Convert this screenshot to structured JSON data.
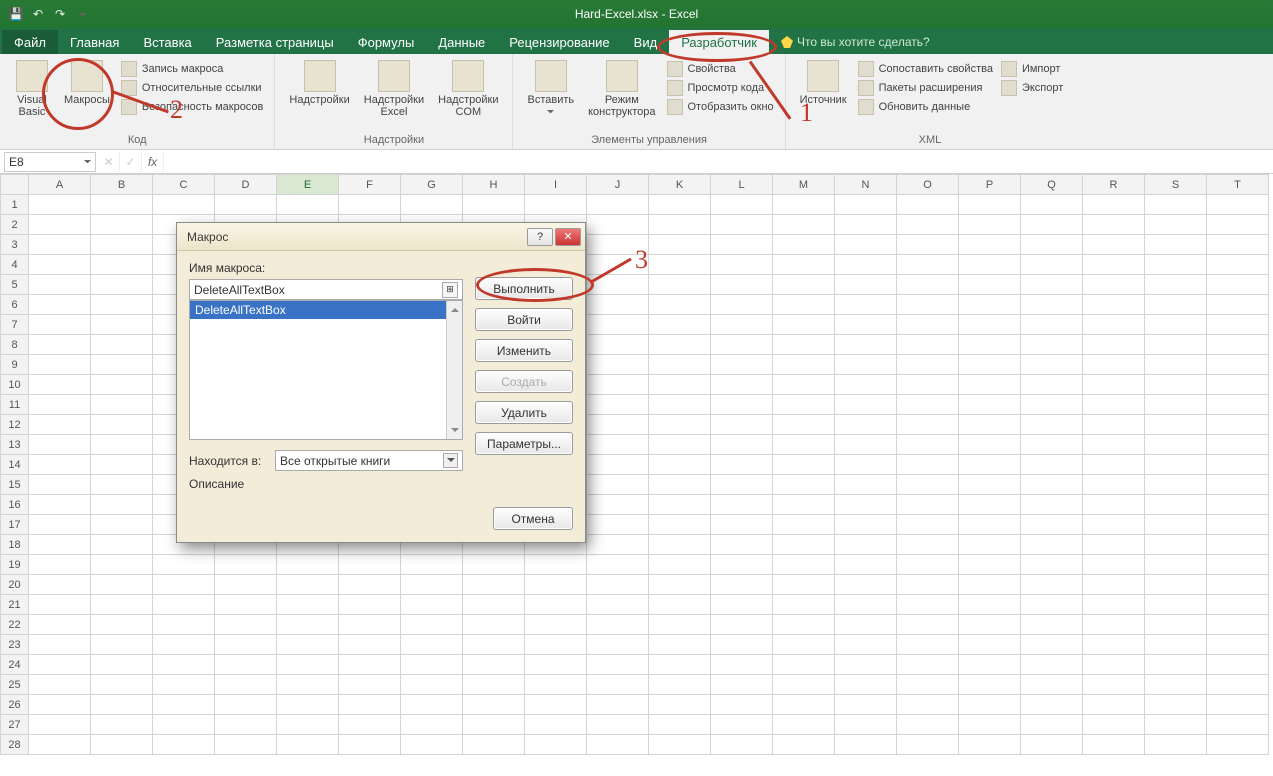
{
  "title": "Hard-Excel.xlsx - Excel",
  "qat": {
    "save": "save-icon",
    "undo": "undo-icon",
    "redo": "redo-icon"
  },
  "tabs": {
    "file": "Файл",
    "items": [
      "Главная",
      "Вставка",
      "Разметка страницы",
      "Формулы",
      "Данные",
      "Рецензирование",
      "Вид",
      "Разработчик"
    ],
    "active_index": 7,
    "tellme": "Что вы хотите сделать?"
  },
  "ribbon": {
    "group_code": {
      "label": "Код",
      "visual_basic": "Visual\nBasic",
      "macros": "Макросы",
      "record": "Запись макроса",
      "relative": "Относительные ссылки",
      "security": "Безопасность макросов"
    },
    "group_addins": {
      "label": "Надстройки",
      "addins": "Надстройки",
      "excel_addins": "Надстройки\nExcel",
      "com_addins": "Надстройки\nCOM"
    },
    "group_controls": {
      "label": "Элементы управления",
      "insert": "Вставить",
      "design": "Режим\nконструктора",
      "properties": "Свойства",
      "view_code": "Просмотр кода",
      "show_window": "Отобразить окно"
    },
    "group_xml": {
      "label": "XML",
      "source": "Источник",
      "map_props": "Сопоставить свойства",
      "exp_packs": "Пакеты расширения",
      "refresh": "Обновить данные",
      "import": "Импорт",
      "export": "Экспорт"
    }
  },
  "formula_bar": {
    "cell_ref": "E8",
    "formula": ""
  },
  "grid": {
    "columns": [
      "A",
      "B",
      "C",
      "D",
      "E",
      "F",
      "G",
      "H",
      "I",
      "J",
      "K",
      "L",
      "M",
      "N",
      "O",
      "P",
      "Q",
      "R",
      "S",
      "T"
    ],
    "rows": 28,
    "active_col": "E",
    "active_row": 8
  },
  "dialog": {
    "title": "Макрос",
    "name_label": "Имя макроса:",
    "name_value": "DeleteAllTextBox",
    "list": [
      "DeleteAllTextBox"
    ],
    "in_label": "Находится в:",
    "in_value": "Все открытые книги",
    "desc_label": "Описание",
    "buttons": {
      "run": "Выполнить",
      "step": "Войти",
      "edit": "Изменить",
      "create": "Создать",
      "delete": "Удалить",
      "options": "Параметры...",
      "cancel": "Отмена"
    }
  },
  "annotations": {
    "n1": "1",
    "n2": "2",
    "n3": "3"
  }
}
